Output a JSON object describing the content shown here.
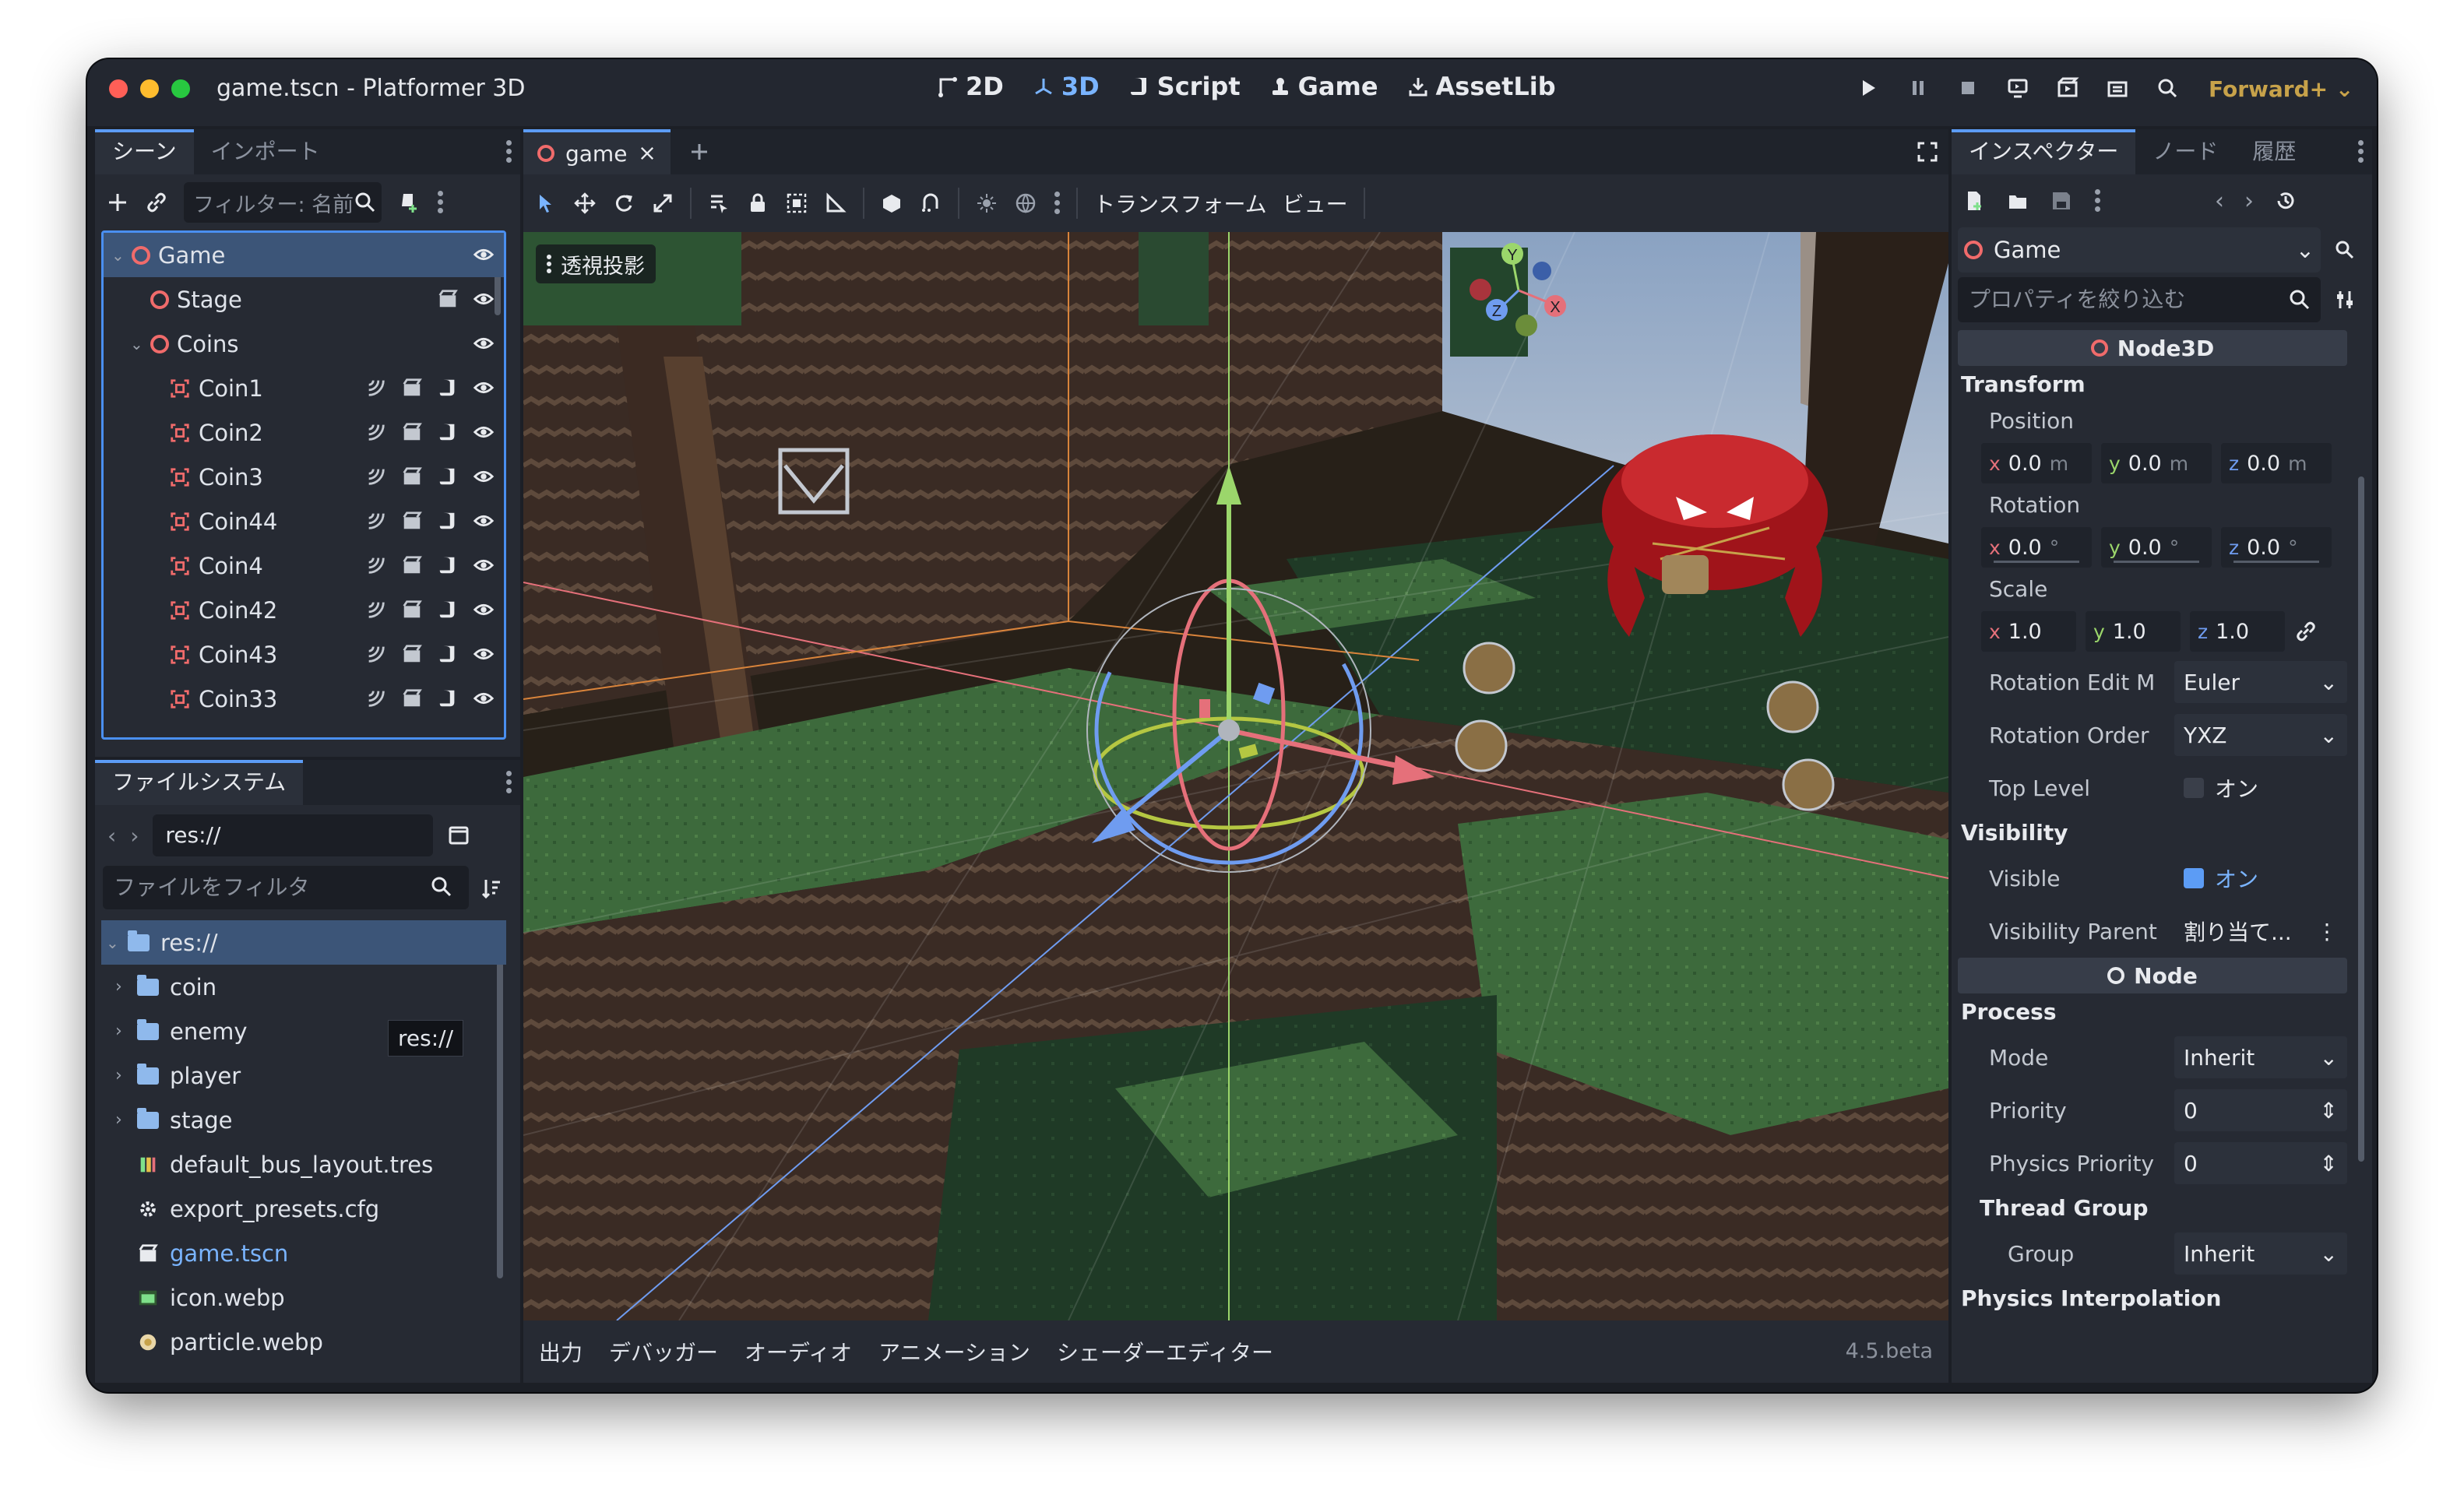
{
  "window": {
    "title": "game.tscn - Platformer 3D"
  },
  "modes": [
    {
      "label": "2D",
      "icon": "2d-icon"
    },
    {
      "label": "3D",
      "icon": "3d-icon"
    },
    {
      "label": "Script",
      "icon": "script-icon"
    },
    {
      "label": "Game",
      "icon": "game-icon"
    },
    {
      "label": "AssetLib",
      "icon": "assetlib-icon"
    }
  ],
  "renderer": "Forward+",
  "colors": {
    "accent": "#5c9cf5",
    "node3d": "#f06b6b",
    "renderer": "#c7a24a"
  },
  "scene_panel": {
    "tabs": [
      "シーン",
      "インポート"
    ],
    "filter_placeholder": "フィルター: 名前",
    "tree": [
      {
        "name": "Game",
        "depth": 0,
        "expander": "down",
        "icon": "node3d-icon",
        "selected": true
      },
      {
        "name": "Stage",
        "depth": 1,
        "icon": "node3d-icon"
      },
      {
        "name": "Coins",
        "depth": 1,
        "expander": "down",
        "icon": "node3d-icon"
      },
      {
        "name": "Coin1",
        "depth": 2,
        "icon": "area3d-icon"
      },
      {
        "name": "Coin2",
        "depth": 2,
        "icon": "area3d-icon"
      },
      {
        "name": "Coin3",
        "depth": 2,
        "icon": "area3d-icon"
      },
      {
        "name": "Coin44",
        "depth": 2,
        "icon": "area3d-icon"
      },
      {
        "name": "Coin4",
        "depth": 2,
        "icon": "area3d-icon"
      },
      {
        "name": "Coin42",
        "depth": 2,
        "icon": "area3d-icon"
      },
      {
        "name": "Coin43",
        "depth": 2,
        "icon": "area3d-icon"
      },
      {
        "name": "Coin33",
        "depth": 2,
        "icon": "area3d-icon"
      }
    ]
  },
  "filesystem": {
    "tab": "ファイルシステム",
    "path": "res://",
    "filter_placeholder": "ファイルをフィルタ",
    "tooltip": "res://",
    "items": [
      {
        "name": "res://",
        "type": "folder",
        "depth": 0,
        "expander": "down",
        "selected": true
      },
      {
        "name": "coin",
        "type": "folder",
        "depth": 1,
        "expander": "right"
      },
      {
        "name": "enemy",
        "type": "folder",
        "depth": 1,
        "expander": "right"
      },
      {
        "name": "player",
        "type": "folder",
        "depth": 1,
        "expander": "right"
      },
      {
        "name": "stage",
        "type": "folder",
        "depth": 1,
        "expander": "right"
      },
      {
        "name": "default_bus_layout.tres",
        "type": "bus-layout",
        "depth": 1
      },
      {
        "name": "export_presets.cfg",
        "type": "config",
        "depth": 1
      },
      {
        "name": "game.tscn",
        "type": "scene",
        "depth": 1,
        "highlight": true
      },
      {
        "name": "icon.webp",
        "type": "image",
        "depth": 1
      },
      {
        "name": "particle.webp",
        "type": "image",
        "depth": 1
      }
    ]
  },
  "editor": {
    "doc_tab": "game",
    "menus": [
      "トランスフォーム",
      "ビュー"
    ],
    "view_label": "透視投影",
    "bottom_tabs": [
      "出力",
      "デバッガー",
      "オーディオ",
      "アニメーション",
      "シェーダーエディター"
    ],
    "version": "4.5.beta",
    "gizmo_axes": [
      "X",
      "Y",
      "Z"
    ]
  },
  "inspector": {
    "tabs": [
      "インスペクター",
      "ノード",
      "履歴"
    ],
    "node_name": "Game",
    "filter_placeholder": "プロパティを絞り込む",
    "node3d_header": "Node3D",
    "transform_section": "Transform",
    "position": {
      "label": "Position",
      "x": "0.0",
      "y": "0.0",
      "z": "0.0",
      "unit": "m"
    },
    "rotation": {
      "label": "Rotation",
      "x": "0.0",
      "y": "0.0",
      "z": "0.0",
      "unit": "°"
    },
    "scale": {
      "label": "Scale",
      "x": "1.0",
      "y": "1.0",
      "z": "1.0"
    },
    "rotation_edit_mode": {
      "label": "Rotation Edit M",
      "value": "Euler"
    },
    "rotation_order": {
      "label": "Rotation Order",
      "value": "YXZ"
    },
    "top_level": {
      "label": "Top Level",
      "value": "オン",
      "checked": false
    },
    "visibility_section": "Visibility",
    "visible": {
      "label": "Visible",
      "value": "オン",
      "checked": true
    },
    "visibility_parent": {
      "label": "Visibility Parent",
      "value": "割り当て..."
    },
    "node_header": "Node",
    "process_section": "Process",
    "mode": {
      "label": "Mode",
      "value": "Inherit"
    },
    "priority": {
      "label": "Priority",
      "value": "0"
    },
    "physics_priority": {
      "label": "Physics Priority",
      "value": "0"
    },
    "thread_group_section": "Thread Group",
    "group": {
      "label": "Group",
      "value": "Inherit"
    },
    "physics_interp_section": "Physics Interpolation"
  }
}
